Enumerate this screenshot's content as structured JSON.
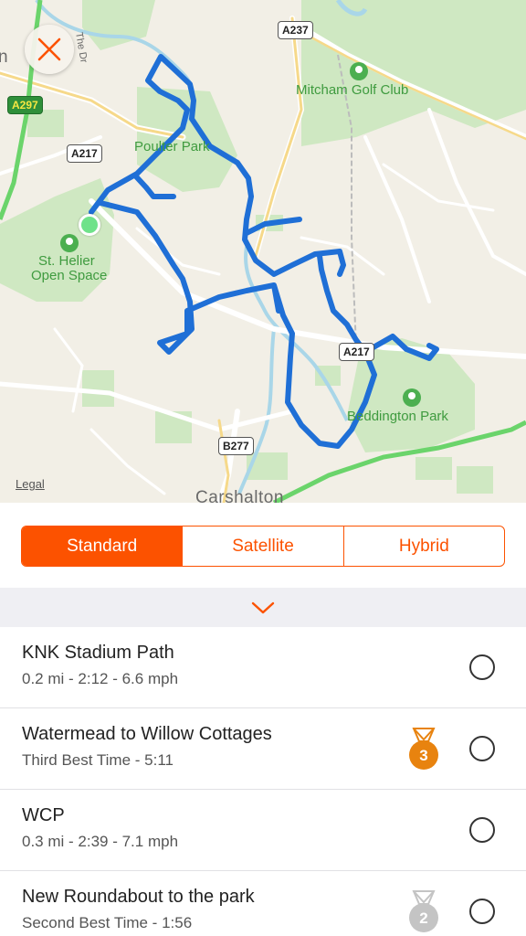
{
  "map": {
    "close_label": "close",
    "legal": "Legal",
    "places": {
      "golf": "Mitcham Golf Club",
      "poulter": "Poulter Park",
      "st_helier_line1": "St. Helier",
      "st_helier_line2": "Open Space",
      "beddington": "Beddington Park",
      "carshalton": "Carshalton",
      "edge_letter": "n",
      "side_road": "The Dr"
    },
    "roads": {
      "a237": "A237",
      "a297": "A297",
      "a217_top": "A217",
      "a217_right": "A217",
      "b277": "B277"
    },
    "route_color": "#1f6fd6",
    "start_color": "#6fe28a"
  },
  "map_type": {
    "options": [
      "Standard",
      "Satellite",
      "Hybrid"
    ],
    "selected": "Standard",
    "accent": "#fc5200"
  },
  "segments": [
    {
      "name": "KNK Stadium Path",
      "detail": "0.2 mi - 2:12 - 6.6 mph",
      "medal": null
    },
    {
      "name": "Watermead to Willow Cottages",
      "detail": "Third Best Time - 5:11",
      "medal": {
        "rank": "3",
        "color": "#e8830f"
      }
    },
    {
      "name": "WCP",
      "detail": "0.3 mi - 2:39 - 7.1 mph",
      "medal": null
    },
    {
      "name": "New Roundabout to the park",
      "detail": "Second Best Time - 1:56",
      "medal": {
        "rank": "2",
        "color": "#c4c4c4"
      }
    }
  ]
}
